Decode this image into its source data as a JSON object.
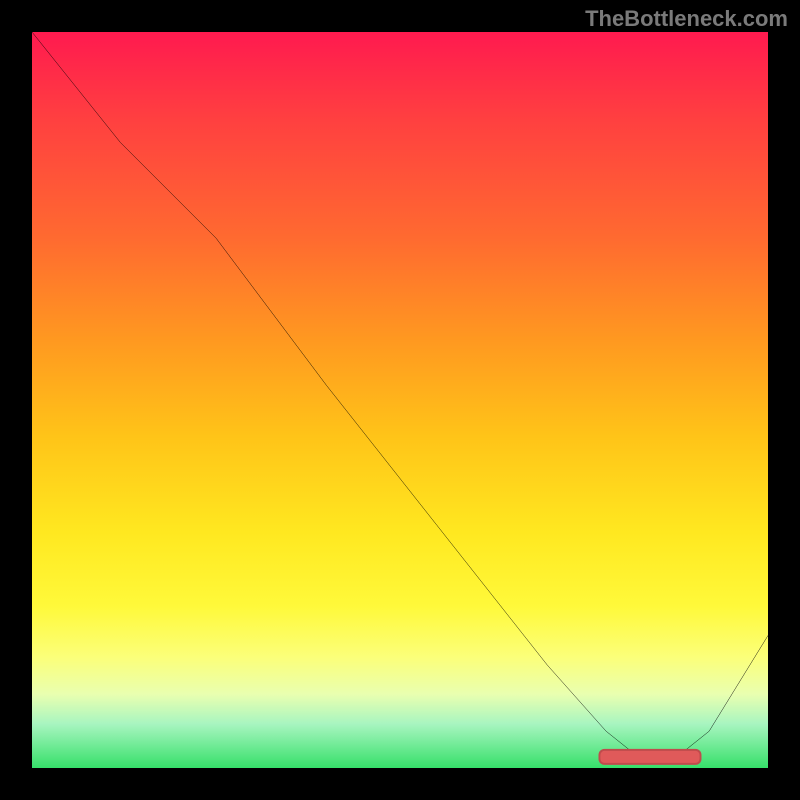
{
  "watermark": "TheBottleneck.com",
  "chart_data": {
    "type": "line",
    "title": "",
    "xlabel": "",
    "ylabel": "",
    "xlim": [
      0,
      100
    ],
    "ylim": [
      0,
      100
    ],
    "grid": false,
    "legend": false,
    "background_gradient": {
      "top": "#ff1a4f",
      "middle": "#ffe820",
      "bottom": "#36e06a"
    },
    "series": [
      {
        "name": "curve",
        "color": "#000000",
        "x": [
          0,
          12,
          25,
          40,
          55,
          70,
          78,
          83,
          87,
          92,
          100
        ],
        "y": [
          100,
          85,
          72,
          52,
          33,
          14,
          5,
          1,
          1,
          5,
          18
        ]
      }
    ],
    "marker": {
      "name": "highlight-segment",
      "color": "#e05a5a",
      "x": 84,
      "y": 1.5,
      "width_pct": 14,
      "height_pct": 2.2
    }
  }
}
